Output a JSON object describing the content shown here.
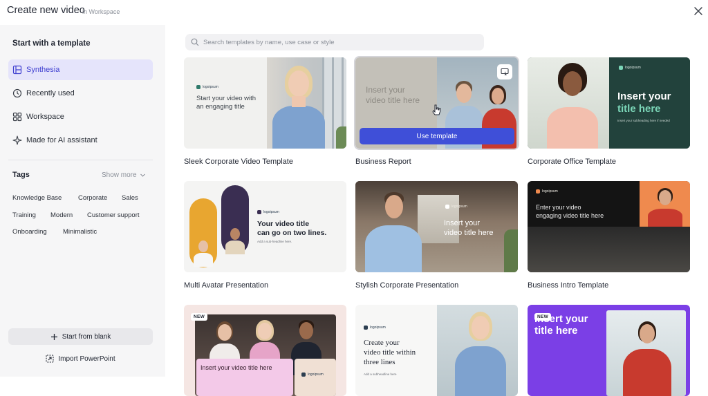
{
  "header": {
    "title": "Create new video",
    "subtitle": "in Workspace"
  },
  "sidebar": {
    "heading": "Start with a template",
    "nav": [
      {
        "label": "Synthesia",
        "icon": "layout-icon",
        "active": true
      },
      {
        "label": "Recently used",
        "icon": "clock-icon",
        "active": false
      },
      {
        "label": "Workspace",
        "icon": "grid-icon",
        "active": false
      },
      {
        "label": "Made for AI assistant",
        "icon": "sparkle-icon",
        "active": false
      }
    ],
    "tags_heading": "Tags",
    "show_more": "Show more",
    "tags": [
      "Knowledge Base",
      "Corporate",
      "Sales",
      "Training",
      "Modern",
      "Customer support",
      "Onboarding",
      "Minimalistic"
    ],
    "start_blank": "Start from blank",
    "import_ppt": "Import PowerPoint"
  },
  "search": {
    "placeholder": "Search templates by name, use case or style",
    "value": ""
  },
  "templates": [
    {
      "label": "Sleek Corporate Video Template",
      "thumb_text": [
        "Start your video with",
        "an engaging title"
      ],
      "logo": "logoipsum"
    },
    {
      "label": "Business Report",
      "thumb_text": [
        "Insert your",
        "video title here"
      ],
      "hovered": true,
      "action": "Use template"
    },
    {
      "label": "Corporate Office Template",
      "thumb_text": [
        "Insert your",
        "title here"
      ],
      "thumb_sub": "Insert your subheading here if needed",
      "logo": "logoipsum"
    },
    {
      "label": "Multi Avatar Presentation",
      "thumb_text": [
        "Your video title",
        "can go on two lines."
      ],
      "thumb_sub": "Add a sub-headline here.",
      "logo": "logoipsum"
    },
    {
      "label": "Stylish Corporate Presentation",
      "thumb_text": [
        "Insert your",
        "video title here"
      ],
      "logo": "logoipsum"
    },
    {
      "label": "Business Intro Template",
      "thumb_text": [
        "Enter your video",
        "engaging video title here"
      ],
      "logo": "logoipsum"
    },
    {
      "label": "",
      "badge": "NEW",
      "thumb_text": [
        "Insert your video title here"
      ],
      "logo": "logoipsum"
    },
    {
      "label": "",
      "thumb_text": [
        "Create your",
        "video title within",
        "three lines"
      ],
      "thumb_sub": "Add a subheadline here",
      "logo": "logoipsum"
    },
    {
      "label": "",
      "badge": "NEW",
      "thumb_text": [
        "Insert your",
        "title here"
      ]
    }
  ],
  "colors": {
    "accent": "#3f4fd8",
    "active_nav_bg": "#e5e4fb",
    "active_nav_text": "#3f3fd0",
    "sidebar_bg": "#f6f6f7",
    "purple_card": "#7b3fe6",
    "orange_card": "#ef8a4e"
  }
}
